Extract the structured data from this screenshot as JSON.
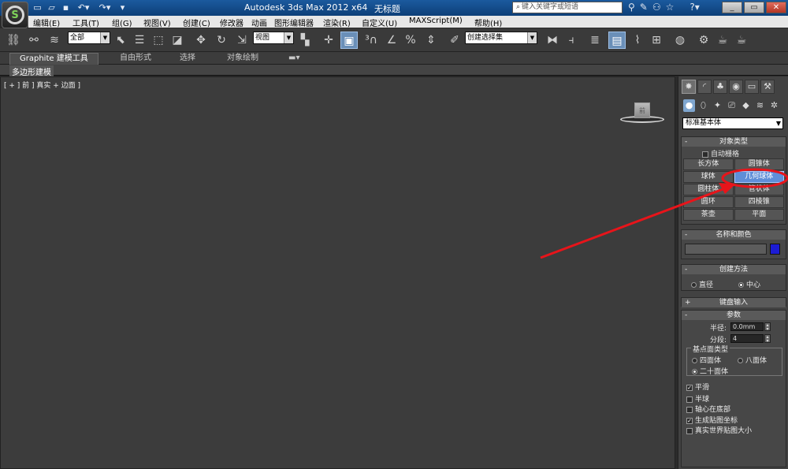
{
  "titlebar": {
    "app_title": "Autodesk 3ds Max  2012 x64",
    "doc_title": "无标题",
    "search_placeholder": "键入关键字或短语"
  },
  "menus": [
    "编辑(E)",
    "工具(T)",
    "组(G)",
    "视图(V)",
    "创建(C)",
    "修改器",
    "动画",
    "图形编辑器",
    "渲染(R)",
    "自定义(U)",
    "MAXScript(M)",
    "帮助(H)"
  ],
  "toolbar": {
    "selection_filter": "全部",
    "ref_coord": "视图",
    "named_selection": "创建选择集"
  },
  "ribbon": {
    "tabs": [
      "Graphite 建模工具",
      "自由形式",
      "选择",
      "对象绘制"
    ],
    "subtab": "多边形建模"
  },
  "viewport": {
    "label": "[ + ] 前 ] 真实 + 边面 ]",
    "viewcube_face": "前"
  },
  "command_panel": {
    "category": "标准基本体",
    "object_type": {
      "title": "对象类型",
      "autogrid": "自动栅格",
      "buttons": [
        "长方体",
        "圆锥体",
        "球体",
        "几何球体",
        "圆柱体",
        "管状体",
        "圆环",
        "四棱锥",
        "茶壶",
        "平面"
      ],
      "selected": "几何球体"
    },
    "name_color": {
      "title": "名称和颜色",
      "color": "#1c1cd4"
    },
    "creation_method": {
      "title": "创建方法",
      "options": [
        "直径",
        "中心"
      ],
      "selected": "中心"
    },
    "keyboard_entry": {
      "title": "键盘输入"
    },
    "parameters": {
      "title": "参数",
      "radius_label": "半径:",
      "radius_value": "0.0mm",
      "segments_label": "分段:",
      "segments_value": "4",
      "base_type_title": "基点面类型",
      "base_types": [
        "四面体",
        "八面体",
        "二十面体"
      ],
      "base_selected": "二十面体",
      "checks": [
        {
          "label": "平滑",
          "checked": true
        },
        {
          "label": "半球",
          "checked": false
        },
        {
          "label": "轴心在底部",
          "checked": false
        },
        {
          "label": "生成贴图坐标",
          "checked": true
        },
        {
          "label": "真实世界贴图大小",
          "checked": false
        }
      ]
    }
  },
  "annotation_color": "#e8141a"
}
